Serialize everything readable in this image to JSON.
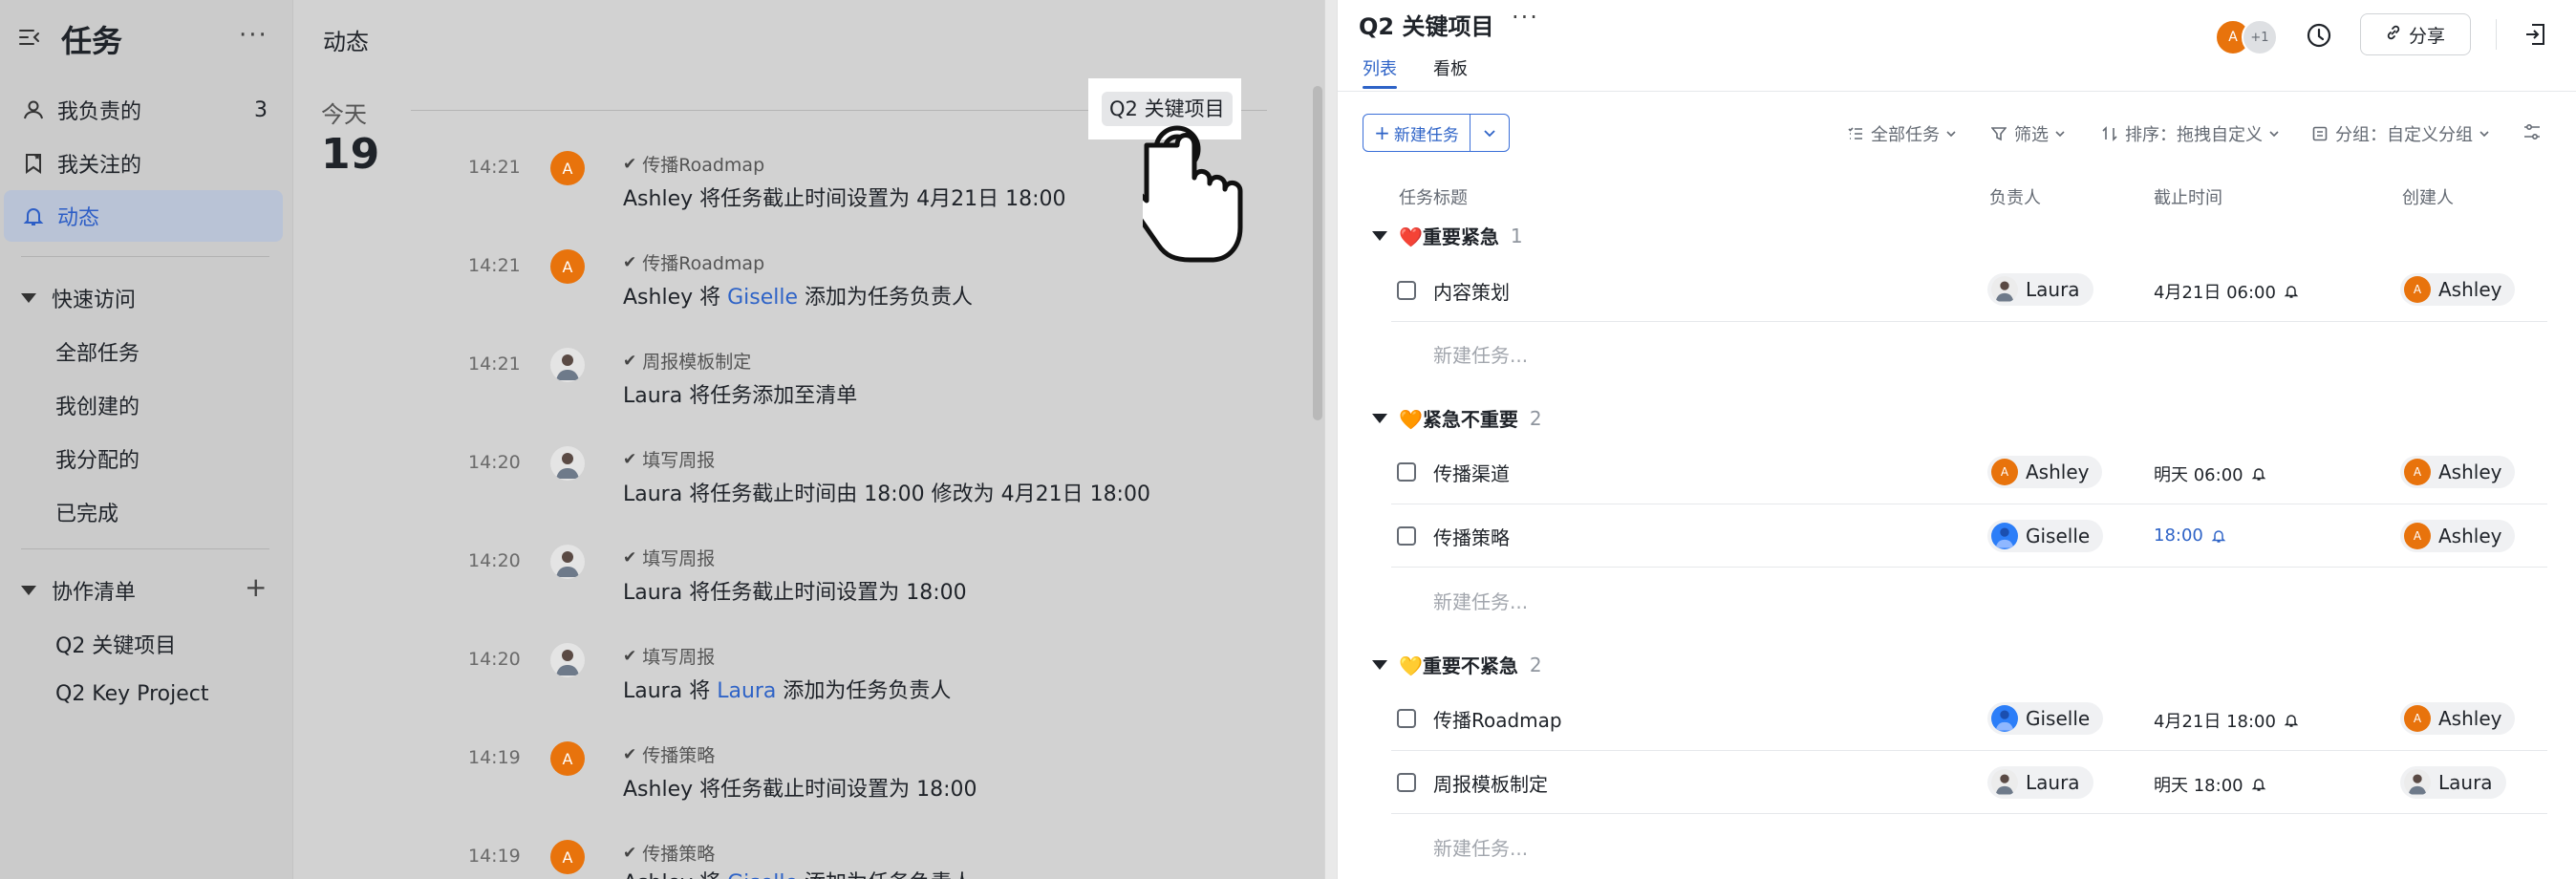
{
  "sidebar": {
    "title": "任务",
    "items": [
      {
        "label": "我负责的",
        "count": "3"
      },
      {
        "label": "我关注的"
      },
      {
        "label": "动态"
      }
    ],
    "quick_access": {
      "title": "快速访问",
      "items": [
        "全部任务",
        "我创建的",
        "我分配的",
        "已完成"
      ]
    },
    "lists": {
      "title": "协作清单",
      "items": [
        "Q2 关键项目",
        "Q2 Key Project"
      ]
    }
  },
  "feed": {
    "title": "动态",
    "day_label": "今天",
    "day_number": "19",
    "tooltip": "Q2 关键项目",
    "entries": [
      {
        "time": "14:21",
        "avatar": "A",
        "task": "传播Roadmap",
        "action": "Ashley 将任务截止时间设置为 4月21日 18:00"
      },
      {
        "time": "14:21",
        "avatar": "A",
        "task": "传播Roadmap",
        "action_pre": "Ashley 将 ",
        "action_link": "Giselle",
        "action_post": " 添加为任务负责人"
      },
      {
        "time": "14:21",
        "avatar": "photo",
        "task": "周报模板制定",
        "action": "Laura 将任务添加至清单"
      },
      {
        "time": "14:20",
        "avatar": "photo",
        "task": "填写周报",
        "action": "Laura 将任务截止时间由 18:00 修改为 4月21日 18:00"
      },
      {
        "time": "14:20",
        "avatar": "photo",
        "task": "填写周报",
        "action": "Laura 将任务截止时间设置为 18:00"
      },
      {
        "time": "14:20",
        "avatar": "photo",
        "task": "填写周报",
        "action_pre": "Laura 将 ",
        "action_link": "Laura",
        "action_post": " 添加为任务负责人"
      },
      {
        "time": "14:19",
        "avatar": "A",
        "task": "传播策略",
        "action": "Ashley 将任务截止时间设置为 18:00"
      },
      {
        "time": "14:19",
        "avatar": "A",
        "task": "传播策略",
        "action_pre": "Ashley 将 ",
        "action_link": "Giselle",
        "action_post": " 添加为任务负责人"
      }
    ]
  },
  "project": {
    "title": "Q2 关键项目",
    "member_extra": "+1",
    "member_initial": "A",
    "share_label": "分享",
    "tabs": [
      "列表",
      "看板"
    ],
    "new_task_button": "新建任务",
    "toolbar": {
      "all_tasks": "全部任务",
      "filter": "筛选",
      "sort": "排序：拖拽自定义",
      "group": "分组：自定义分组"
    },
    "columns": [
      "任务标题",
      "负责人",
      "截止时间",
      "创建人"
    ],
    "new_task_placeholder": "新建任务...",
    "groups": [
      {
        "name": "❤️重要紧急",
        "count": "1",
        "tasks": [
          {
            "title": "内容策划",
            "assignee": "Laura",
            "due": "4月21日 06:00",
            "creator": "Ashley"
          }
        ]
      },
      {
        "name": "🧡紧急不重要",
        "count": "2",
        "tasks": [
          {
            "title": "传播渠道",
            "assignee": "Ashley",
            "due": "明天 06:00",
            "creator": "Ashley"
          },
          {
            "title": "传播策略",
            "assignee": "Giselle",
            "due": "18:00",
            "creator": "Ashley"
          }
        ]
      },
      {
        "name": "💛重要不紧急",
        "count": "2",
        "tasks": [
          {
            "title": "传播Roadmap",
            "assignee": "Giselle",
            "due": "4月21日 18:00",
            "creator": "Ashley"
          },
          {
            "title": "周报模板制定",
            "assignee": "Laura",
            "due": "明天 18:00",
            "creator": "Laura"
          }
        ]
      }
    ]
  },
  "colors": {
    "accent": "#2e63c7",
    "orange_avatar": "#e8730c",
    "blue_avatar": "#2c7ef8",
    "dim_overlay": "#d2d2d2"
  }
}
